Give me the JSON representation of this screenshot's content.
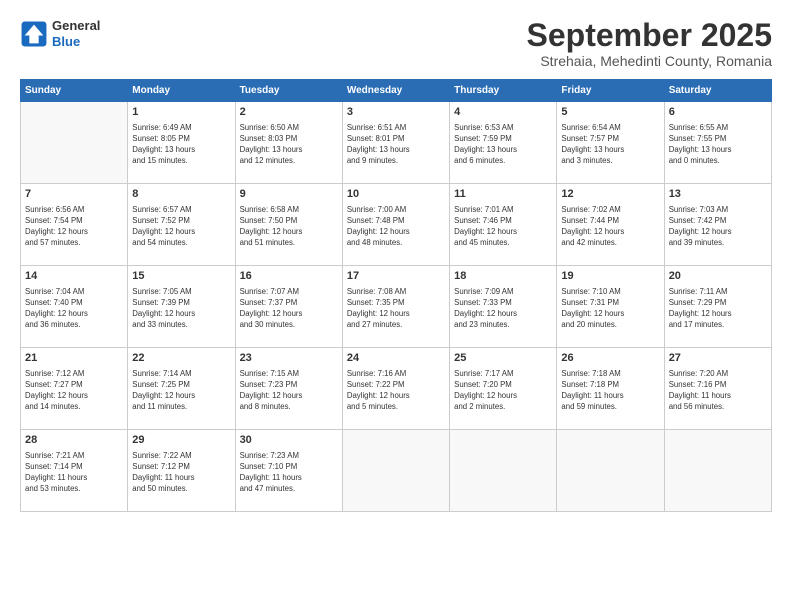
{
  "header": {
    "logo_line1": "General",
    "logo_line2": "Blue",
    "month": "September 2025",
    "location": "Strehaia, Mehedinti County, Romania"
  },
  "weekdays": [
    "Sunday",
    "Monday",
    "Tuesday",
    "Wednesday",
    "Thursday",
    "Friday",
    "Saturday"
  ],
  "weeks": [
    [
      {
        "day": "",
        "info": ""
      },
      {
        "day": "1",
        "info": "Sunrise: 6:49 AM\nSunset: 8:05 PM\nDaylight: 13 hours\nand 15 minutes."
      },
      {
        "day": "2",
        "info": "Sunrise: 6:50 AM\nSunset: 8:03 PM\nDaylight: 13 hours\nand 12 minutes."
      },
      {
        "day": "3",
        "info": "Sunrise: 6:51 AM\nSunset: 8:01 PM\nDaylight: 13 hours\nand 9 minutes."
      },
      {
        "day": "4",
        "info": "Sunrise: 6:53 AM\nSunset: 7:59 PM\nDaylight: 13 hours\nand 6 minutes."
      },
      {
        "day": "5",
        "info": "Sunrise: 6:54 AM\nSunset: 7:57 PM\nDaylight: 13 hours\nand 3 minutes."
      },
      {
        "day": "6",
        "info": "Sunrise: 6:55 AM\nSunset: 7:55 PM\nDaylight: 13 hours\nand 0 minutes."
      }
    ],
    [
      {
        "day": "7",
        "info": "Sunrise: 6:56 AM\nSunset: 7:54 PM\nDaylight: 12 hours\nand 57 minutes."
      },
      {
        "day": "8",
        "info": "Sunrise: 6:57 AM\nSunset: 7:52 PM\nDaylight: 12 hours\nand 54 minutes."
      },
      {
        "day": "9",
        "info": "Sunrise: 6:58 AM\nSunset: 7:50 PM\nDaylight: 12 hours\nand 51 minutes."
      },
      {
        "day": "10",
        "info": "Sunrise: 7:00 AM\nSunset: 7:48 PM\nDaylight: 12 hours\nand 48 minutes."
      },
      {
        "day": "11",
        "info": "Sunrise: 7:01 AM\nSunset: 7:46 PM\nDaylight: 12 hours\nand 45 minutes."
      },
      {
        "day": "12",
        "info": "Sunrise: 7:02 AM\nSunset: 7:44 PM\nDaylight: 12 hours\nand 42 minutes."
      },
      {
        "day": "13",
        "info": "Sunrise: 7:03 AM\nSunset: 7:42 PM\nDaylight: 12 hours\nand 39 minutes."
      }
    ],
    [
      {
        "day": "14",
        "info": "Sunrise: 7:04 AM\nSunset: 7:40 PM\nDaylight: 12 hours\nand 36 minutes."
      },
      {
        "day": "15",
        "info": "Sunrise: 7:05 AM\nSunset: 7:39 PM\nDaylight: 12 hours\nand 33 minutes."
      },
      {
        "day": "16",
        "info": "Sunrise: 7:07 AM\nSunset: 7:37 PM\nDaylight: 12 hours\nand 30 minutes."
      },
      {
        "day": "17",
        "info": "Sunrise: 7:08 AM\nSunset: 7:35 PM\nDaylight: 12 hours\nand 27 minutes."
      },
      {
        "day": "18",
        "info": "Sunrise: 7:09 AM\nSunset: 7:33 PM\nDaylight: 12 hours\nand 23 minutes."
      },
      {
        "day": "19",
        "info": "Sunrise: 7:10 AM\nSunset: 7:31 PM\nDaylight: 12 hours\nand 20 minutes."
      },
      {
        "day": "20",
        "info": "Sunrise: 7:11 AM\nSunset: 7:29 PM\nDaylight: 12 hours\nand 17 minutes."
      }
    ],
    [
      {
        "day": "21",
        "info": "Sunrise: 7:12 AM\nSunset: 7:27 PM\nDaylight: 12 hours\nand 14 minutes."
      },
      {
        "day": "22",
        "info": "Sunrise: 7:14 AM\nSunset: 7:25 PM\nDaylight: 12 hours\nand 11 minutes."
      },
      {
        "day": "23",
        "info": "Sunrise: 7:15 AM\nSunset: 7:23 PM\nDaylight: 12 hours\nand 8 minutes."
      },
      {
        "day": "24",
        "info": "Sunrise: 7:16 AM\nSunset: 7:22 PM\nDaylight: 12 hours\nand 5 minutes."
      },
      {
        "day": "25",
        "info": "Sunrise: 7:17 AM\nSunset: 7:20 PM\nDaylight: 12 hours\nand 2 minutes."
      },
      {
        "day": "26",
        "info": "Sunrise: 7:18 AM\nSunset: 7:18 PM\nDaylight: 11 hours\nand 59 minutes."
      },
      {
        "day": "27",
        "info": "Sunrise: 7:20 AM\nSunset: 7:16 PM\nDaylight: 11 hours\nand 56 minutes."
      }
    ],
    [
      {
        "day": "28",
        "info": "Sunrise: 7:21 AM\nSunset: 7:14 PM\nDaylight: 11 hours\nand 53 minutes."
      },
      {
        "day": "29",
        "info": "Sunrise: 7:22 AM\nSunset: 7:12 PM\nDaylight: 11 hours\nand 50 minutes."
      },
      {
        "day": "30",
        "info": "Sunrise: 7:23 AM\nSunset: 7:10 PM\nDaylight: 11 hours\nand 47 minutes."
      },
      {
        "day": "",
        "info": ""
      },
      {
        "day": "",
        "info": ""
      },
      {
        "day": "",
        "info": ""
      },
      {
        "day": "",
        "info": ""
      }
    ]
  ]
}
